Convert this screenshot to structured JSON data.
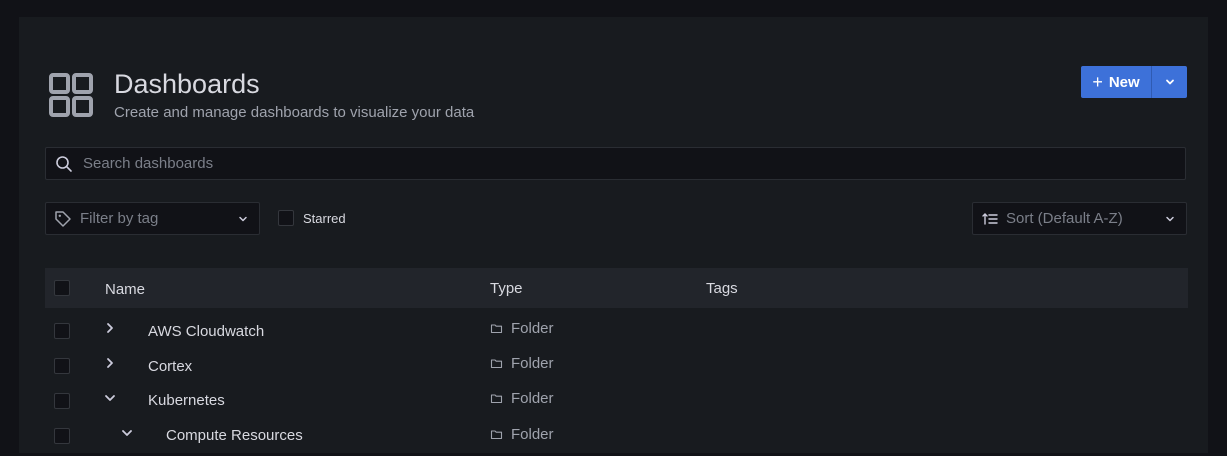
{
  "header": {
    "title": "Dashboards",
    "subtitle": "Create and manage dashboards to visualize your data",
    "icon": "dashboards-grid-icon"
  },
  "new_button": {
    "plus": "+",
    "label": "New"
  },
  "search": {
    "placeholder": "Search dashboards",
    "value": ""
  },
  "filters": {
    "tag_placeholder": "Filter by tag",
    "starred_label": "Starred",
    "sort_placeholder": "Sort (Default A-Z)"
  },
  "table": {
    "columns": {
      "name": "Name",
      "type": "Type",
      "tags": "Tags"
    },
    "rows": [
      {
        "name": "AWS Cloudwatch",
        "type": "Folder",
        "expanded": false,
        "level": 0
      },
      {
        "name": "Cortex",
        "type": "Folder",
        "expanded": false,
        "level": 0
      },
      {
        "name": "Kubernetes",
        "type": "Folder",
        "expanded": true,
        "level": 0
      },
      {
        "name": "Compute Resources",
        "type": "Folder",
        "expanded": true,
        "level": 1
      }
    ]
  },
  "colors": {
    "primary": "#3d71d9",
    "background": "#111217",
    "panel": "#181b1f",
    "text": "#d8d9e0",
    "muted": "#9fa3ad"
  }
}
